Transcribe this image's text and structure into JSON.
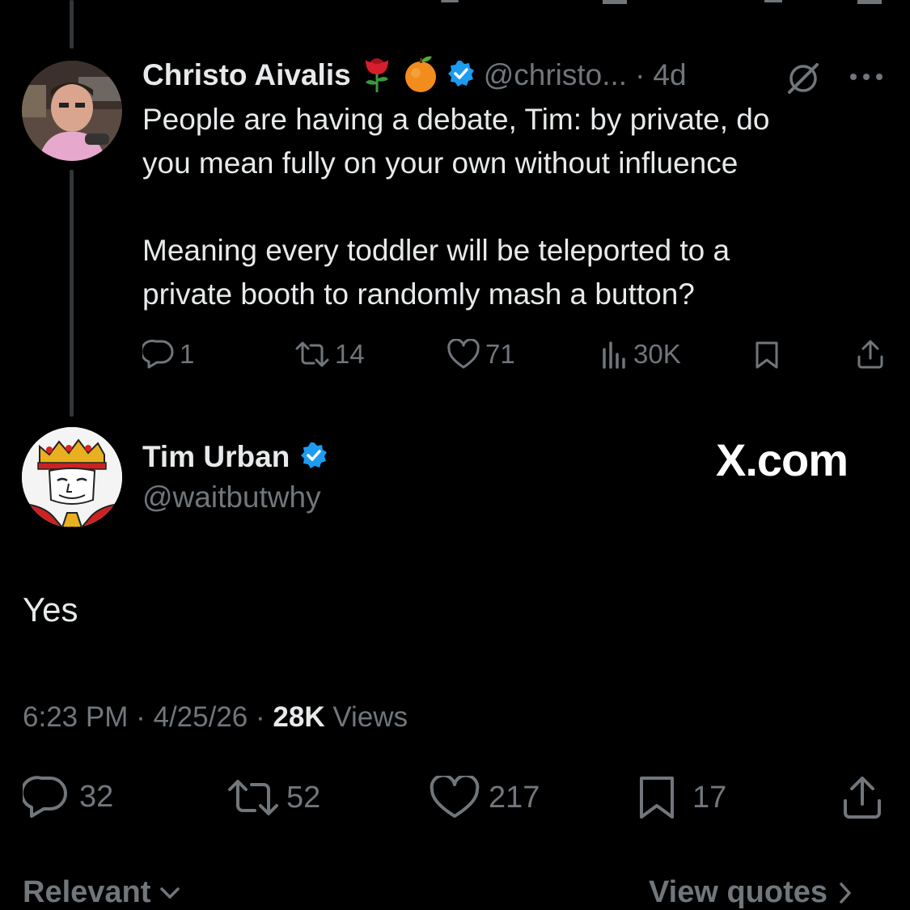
{
  "parent_post": {
    "author_name": "Christo Aivalis",
    "emoji_icons": [
      "rose-icon",
      "orange-icon"
    ],
    "handle": "@christo...",
    "separator": "·",
    "age": "4d",
    "body_line1": "People are having a debate, Tim: by private, do",
    "body_line2": "you mean fully on your own without influence",
    "body_line3": "Meaning every toddler will be teleported to a",
    "body_line4": "private booth to randomly mash a button?",
    "replies": "1",
    "reposts": "14",
    "likes": "71",
    "views": "30K"
  },
  "main_post": {
    "author_name": "Tim Urban",
    "handle": "@waitbutwhy",
    "brand": "X.com",
    "body": "Yes",
    "time": "6:23 PM",
    "date": "4/25/26",
    "separator": "·",
    "views_count": "28K",
    "views_label": "Views",
    "replies": "32",
    "reposts": "52",
    "likes": "217",
    "bookmarks": "17"
  },
  "footer": {
    "sort_label": "Relevant",
    "quotes_label": "View quotes"
  },
  "colors": {
    "background": "#000000",
    "text": "#e7e9ea",
    "muted": "#71767b",
    "verified": "#1d9bf0",
    "thread_line": "#333639"
  }
}
